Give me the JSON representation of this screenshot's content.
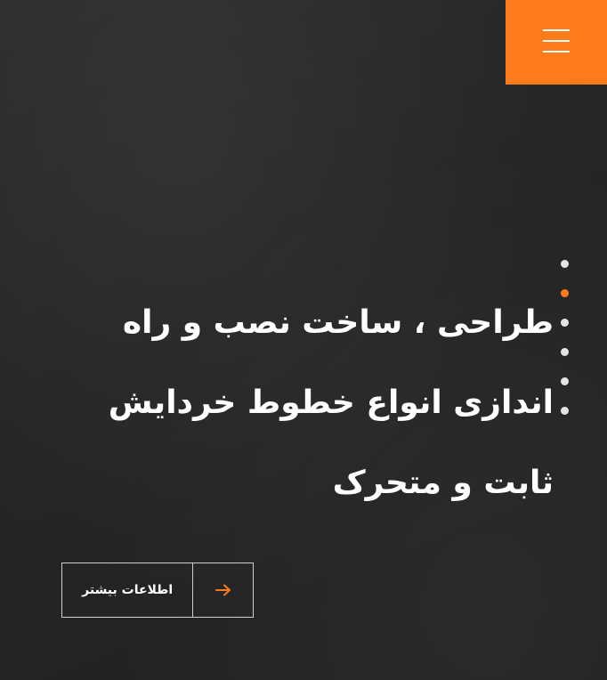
{
  "hero": {
    "headline": "طراحی ، ساخت نصب و راه اندازی انواع خطوط خردایش ثابت و متحرک",
    "cta_label": "اطلاعات بیشتر",
    "cta_icon": "arrow-right-icon"
  },
  "menu": {
    "icon": "hamburger-menu-icon"
  },
  "slider": {
    "slide_count": 6,
    "active_index": 1
  },
  "colors": {
    "accent": "#ff7a1a",
    "background": "#252525",
    "text": "#ffffff"
  }
}
